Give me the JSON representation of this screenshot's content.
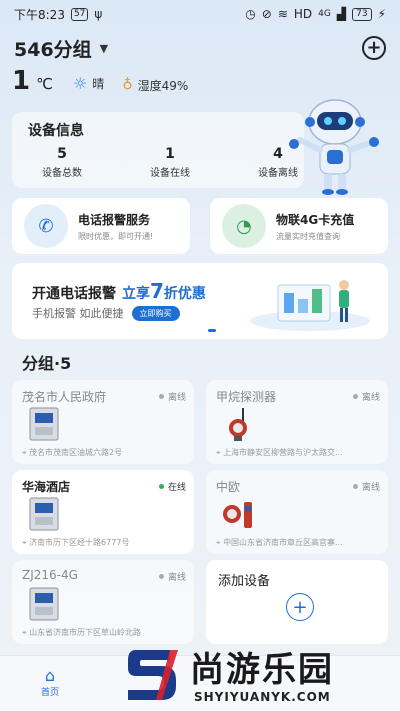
{
  "status_bar": {
    "time": "下午8:23",
    "chip": "57",
    "signal_text": "HD",
    "network": "4G",
    "battery": "73"
  },
  "header": {
    "group_name": "546分组"
  },
  "weather": {
    "temperature": "1",
    "unit": "℃",
    "condition": "晴",
    "humidity": "湿度49%"
  },
  "device_info": {
    "title": "设备信息",
    "stats": [
      {
        "value": "5",
        "label": "设备总数"
      },
      {
        "value": "1",
        "label": "设备在线"
      },
      {
        "value": "4",
        "label": "设备离线"
      }
    ]
  },
  "services": [
    {
      "title": "电话报警服务",
      "subtitle": "限时优惠，即可开通!"
    },
    {
      "title": "物联4G卡充值",
      "subtitle": "流量实时充值查询"
    }
  ],
  "banner": {
    "title": "开通电话报警",
    "accent_prefix": "立享",
    "accent_number": "7",
    "accent_suffix": "折优惠",
    "subtitle": "手机报警  如此便捷",
    "button": "立即购买"
  },
  "groups_title": "分组·5",
  "devices": [
    {
      "name": "茂名市人民政府",
      "status": "离线",
      "address": "茂名市茂南区油城六路2号"
    },
    {
      "name": "甲烷探测器",
      "status": "离线",
      "address": "上海市静安区柳营路与沪太路交..."
    },
    {
      "name": "华海酒店",
      "status": "在线",
      "address": "济南市历下区经十路6777号"
    },
    {
      "name": "中欧",
      "status": "离线",
      "address": "中国山东省济南市章丘区高官寨..."
    },
    {
      "name": "ZJ216-4G",
      "status": "离线",
      "address": "山东省济南市历下区草山岭北路"
    }
  ],
  "add_device": {
    "label": "添加设备"
  },
  "tabbar": {
    "home_label": "首页"
  },
  "watermark": {
    "title": "尚游乐园",
    "url": "SHYIYUANYK.COM"
  },
  "colors": {
    "accent": "#1f6fd3",
    "online": "#2fb052"
  }
}
